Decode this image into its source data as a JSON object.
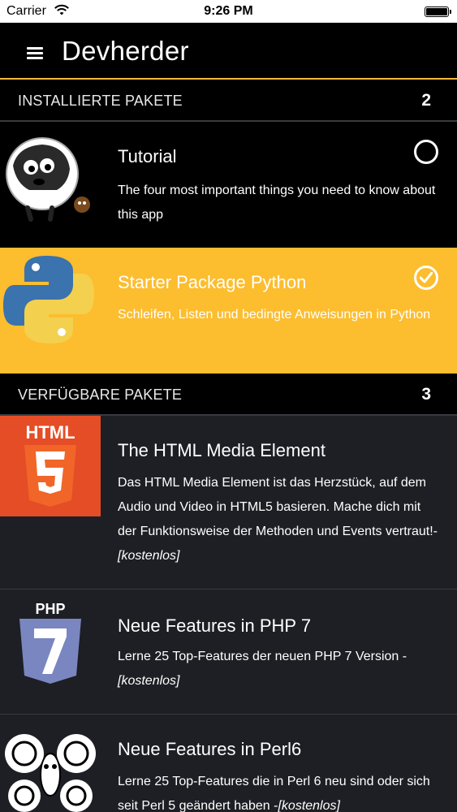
{
  "status_bar": {
    "carrier": "Carrier",
    "time": "9:26 PM"
  },
  "nav": {
    "title": "Devherder"
  },
  "installed": {
    "label": "INSTALLIERTE PAKETE",
    "count": "2",
    "items": [
      {
        "title": "Tutorial",
        "description": "The four most important things you need to know about this app",
        "status": "not-completed"
      },
      {
        "title": "Starter Package Python",
        "description": "Schleifen, Listen und bedingte Anweisungen in Python",
        "status": "completed"
      }
    ]
  },
  "available": {
    "label": "VERFÜGBARE PAKETE",
    "count": "3",
    "items": [
      {
        "title": "The HTML Media Element",
        "description": "Das HTML Media Element ist das Herzstück, auf dem Audio und Video in HTML5 basieren. Mache dich mit der Funktionsweise der Methoden und Events vertraut!-",
        "price": "[kostenlos]",
        "logo_text": "HTML",
        "logo_number": "5"
      },
      {
        "title": "Neue Features in PHP 7",
        "description": "Lerne 25 Top-Features der neuen PHP 7 Version -",
        "price": "[kostenlos]",
        "logo_text": "PHP",
        "logo_number": "7"
      },
      {
        "title": "Neue Features in Perl6",
        "description": "Lerne 25 Top-Features die in Perl 6 neu sind oder sich seit Perl 5 geändert haben -",
        "price": "[kostenlos]"
      }
    ]
  },
  "colors": {
    "accent": "#fcbd2f",
    "background": "#1e1f24",
    "header": "#000000"
  }
}
